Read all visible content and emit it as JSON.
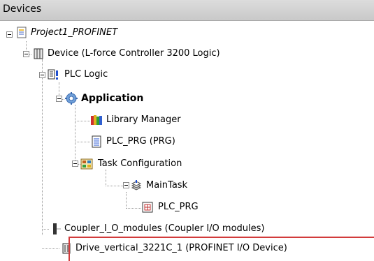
{
  "panel": {
    "title": "Devices"
  },
  "tree": {
    "project": "Project1_PROFINET",
    "device": "Device (L-force Controller 3200 Logic)",
    "plc_logic": "PLC Logic",
    "application": "Application",
    "library_manager": "Library Manager",
    "plc_prg": "PLC_PRG (PRG)",
    "task_configuration": "Task Configuration",
    "main_task": "MainTask",
    "main_task_plc_prg": "PLC_PRG",
    "coupler": "Coupler_I_O_modules (Coupler I/O modules)",
    "drive": "Drive_vertical_3221C_1 (PROFINET I/O Device)"
  },
  "colors": {
    "highlight_border": "#d23b3b",
    "header_bg": "#d4d4d4"
  },
  "icons": [
    "expand-collapse-icon",
    "project-icon",
    "device-icon",
    "plc-logic-icon",
    "application-gear-icon",
    "library-books-icon",
    "program-page-icon",
    "task-configuration-icon",
    "main-task-icon",
    "program-call-icon",
    "coupler-icon",
    "drive-icon"
  ]
}
